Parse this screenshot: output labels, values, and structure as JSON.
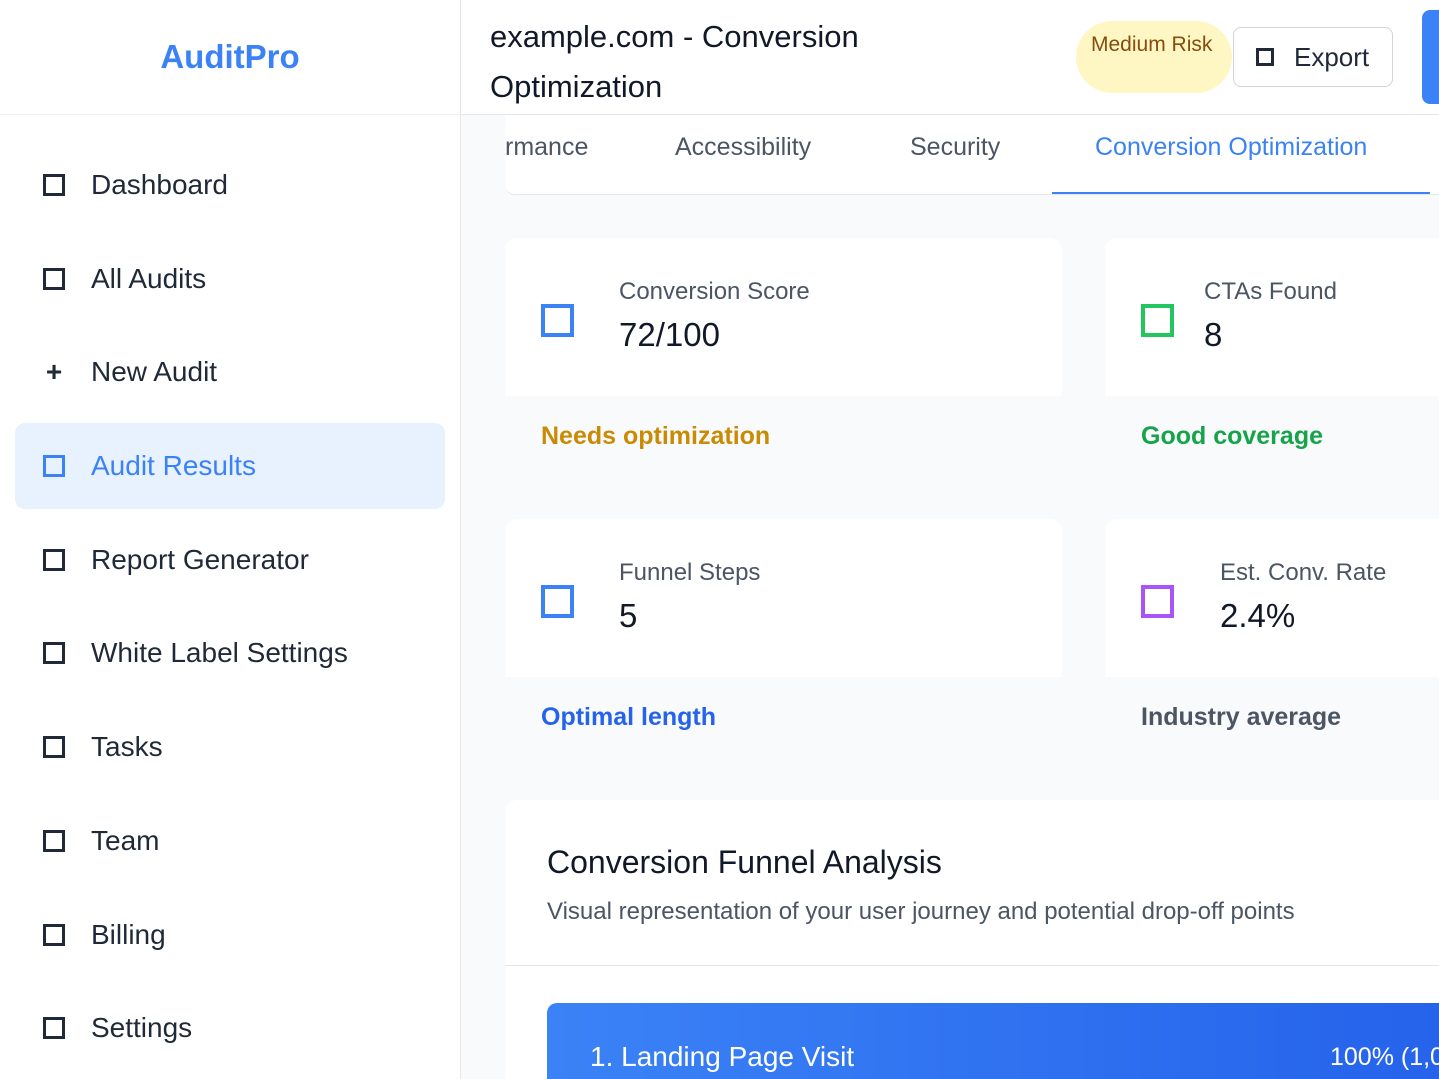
{
  "sidebar": {
    "brand": "AuditPro",
    "items": [
      {
        "label": "Dashboard",
        "icon": "square-icon"
      },
      {
        "label": "All Audits",
        "icon": "square-icon"
      },
      {
        "label": "New Audit",
        "icon": "plus-icon"
      },
      {
        "label": "Audit Results",
        "icon": "square-icon",
        "active": true
      },
      {
        "label": "Report Generator",
        "icon": "square-icon"
      },
      {
        "label": "White Label Settings",
        "icon": "square-icon"
      },
      {
        "label": "Tasks",
        "icon": "square-icon"
      },
      {
        "label": "Team",
        "icon": "square-icon"
      },
      {
        "label": "Billing",
        "icon": "square-icon"
      },
      {
        "label": "Settings",
        "icon": "square-icon"
      }
    ]
  },
  "header": {
    "title": "example.com - Conversion Optimization",
    "risk_badge": "Medium Risk",
    "export_label": "Export"
  },
  "tabs": [
    {
      "label": "rmance"
    },
    {
      "label": "Accessibility"
    },
    {
      "label": "Security"
    },
    {
      "label": "Conversion Optimization",
      "active": true
    }
  ],
  "stats": [
    {
      "label": "Conversion Score",
      "value": "72/100",
      "note": "Needs optimization",
      "icon_color": "#3b82f6",
      "note_color": "#ca8a04"
    },
    {
      "label": "CTAs Found",
      "value": "8",
      "note": "Good coverage",
      "icon_color": "#22c55e",
      "note_color": "#16a34a"
    },
    {
      "label": "Funnel Steps",
      "value": "5",
      "note": "Optimal length",
      "icon_color": "#3b82f6",
      "note_color": "#2563eb"
    },
    {
      "label": "Est. Conv. Rate",
      "value": "2.4%",
      "note": "Industry average",
      "icon_color": "#a855f7",
      "note_color": "#4b5563"
    }
  ],
  "funnel": {
    "title": "Conversion Funnel Analysis",
    "subtitle": "Visual representation of your user journey and potential drop-off points",
    "steps": [
      {
        "label": "1. Landing Page Visit",
        "value": "100% (1,0"
      }
    ]
  },
  "colors": {
    "accent": "#3b82f6",
    "risk_bg": "#fef7c3",
    "risk_text": "#854d0e"
  }
}
